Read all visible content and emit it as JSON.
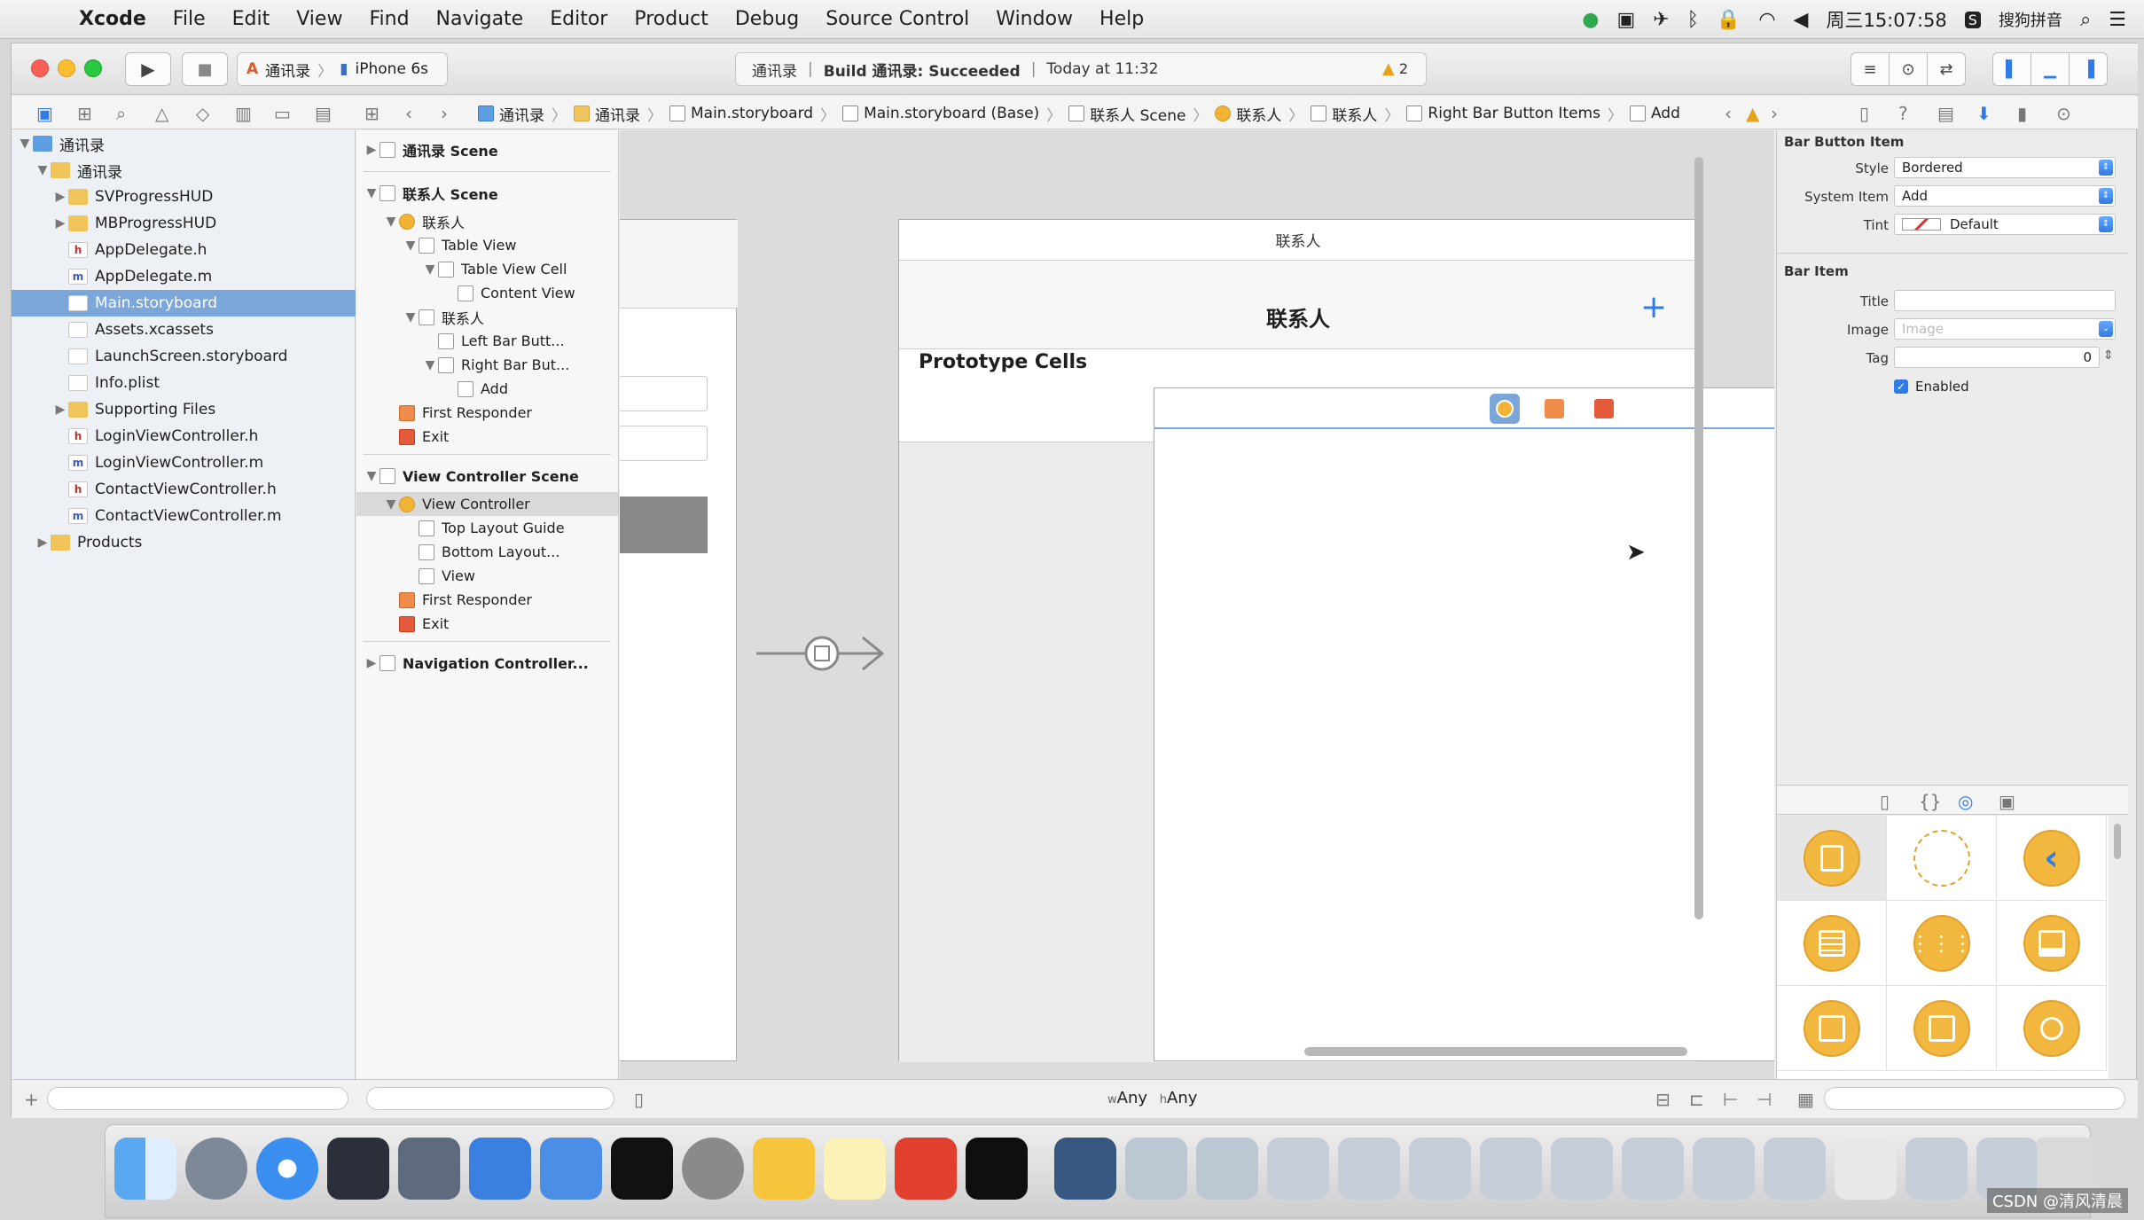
{
  "menubar": {
    "app": "Xcode",
    "items": [
      "File",
      "Edit",
      "View",
      "Find",
      "Navigate",
      "Editor",
      "Product",
      "Debug",
      "Source Control",
      "Window",
      "Help"
    ],
    "clock": "周三15:07:58",
    "input_method": "搜狗拼音"
  },
  "toolbar": {
    "scheme_target": "通讯录",
    "scheme_device": "iPhone 6s",
    "activity_target": "通讯录",
    "activity_build": "Build 通讯录: Succeeded",
    "activity_time": "Today at 11:32",
    "warning_count": "2"
  },
  "jumpbar": [
    "通讯录",
    "通讯录",
    "Main.storyboard",
    "Main.storyboard (Base)",
    "联系人 Scene",
    "联系人",
    "联系人",
    "Right Bar Button Items",
    "Add"
  ],
  "navigator": {
    "project": "通讯录",
    "items": [
      {
        "label": "通讯录",
        "type": "folder",
        "indent": 1,
        "disclosure": "▼"
      },
      {
        "label": "SVProgressHUD",
        "type": "folder",
        "indent": 2,
        "disclosure": "▶"
      },
      {
        "label": "MBProgressHUD",
        "type": "folder",
        "indent": 2,
        "disclosure": "▶"
      },
      {
        "label": "AppDelegate.h",
        "type": "h",
        "indent": 2,
        "disclosure": ""
      },
      {
        "label": "AppDelegate.m",
        "type": "m",
        "indent": 2,
        "disclosure": ""
      },
      {
        "label": "Main.storyboard",
        "type": "s",
        "indent": 2,
        "disclosure": "",
        "selected": true
      },
      {
        "label": "Assets.xcassets",
        "type": "s",
        "indent": 2,
        "disclosure": ""
      },
      {
        "label": "LaunchScreen.storyboard",
        "type": "s",
        "indent": 2,
        "disclosure": ""
      },
      {
        "label": "Info.plist",
        "type": "s",
        "indent": 2,
        "disclosure": ""
      },
      {
        "label": "Supporting Files",
        "type": "folder",
        "indent": 2,
        "disclosure": "▶"
      },
      {
        "label": "LoginViewController.h",
        "type": "h",
        "indent": 2,
        "disclosure": ""
      },
      {
        "label": "LoginViewController.m",
        "type": "m",
        "indent": 2,
        "disclosure": ""
      },
      {
        "label": "ContactViewController.h",
        "type": "h",
        "indent": 2,
        "disclosure": ""
      },
      {
        "label": "ContactViewController.m",
        "type": "m",
        "indent": 2,
        "disclosure": ""
      },
      {
        "label": "Products",
        "type": "folder",
        "indent": 1,
        "disclosure": "▶"
      }
    ]
  },
  "outline": {
    "rows": [
      {
        "label": "通讯录 Scene",
        "indent": 0,
        "disclosure": "▶",
        "section": true
      },
      {
        "label": "联系人 Scene",
        "indent": 0,
        "disclosure": "▼",
        "section": true
      },
      {
        "label": "联系人",
        "indent": 1,
        "disclosure": "▼",
        "icon": "vc"
      },
      {
        "label": "Table View",
        "indent": 2,
        "disclosure": "▼"
      },
      {
        "label": "Table View Cell",
        "indent": 3,
        "disclosure": "▼"
      },
      {
        "label": "Content View",
        "indent": 4,
        "disclosure": ""
      },
      {
        "label": "联系人",
        "indent": 2,
        "disclosure": "▼",
        "icon": "nav"
      },
      {
        "label": "Left Bar Butt...",
        "indent": 3,
        "disclosure": ""
      },
      {
        "label": "Right Bar But...",
        "indent": 3,
        "disclosure": "▼"
      },
      {
        "label": "Add",
        "indent": 4,
        "disclosure": ""
      },
      {
        "label": "First Responder",
        "indent": 1,
        "disclosure": "",
        "icon": "resp"
      },
      {
        "label": "Exit",
        "indent": 1,
        "disclosure": "",
        "icon": "exit"
      },
      {
        "label": "View Controller Scene",
        "indent": 0,
        "disclosure": "▼",
        "section": true
      },
      {
        "label": "View Controller",
        "indent": 1,
        "disclosure": "▼",
        "icon": "vc",
        "selected": true
      },
      {
        "label": "Top Layout Guide",
        "indent": 2,
        "disclosure": ""
      },
      {
        "label": "Bottom Layout...",
        "indent": 2,
        "disclosure": ""
      },
      {
        "label": "View",
        "indent": 2,
        "disclosure": ""
      },
      {
        "label": "First Responder",
        "indent": 1,
        "disclosure": "",
        "icon": "resp"
      },
      {
        "label": "Exit",
        "indent": 1,
        "disclosure": "",
        "icon": "exit"
      },
      {
        "label": "Navigation Controller...",
        "indent": 0,
        "disclosure": "▶",
        "section": true
      }
    ]
  },
  "canvas": {
    "scene_title": "联系人",
    "nav_title": "联系人",
    "add_symbol": "+",
    "prototype_label": "Prototype Cells",
    "size_class_w": "Any",
    "size_class_h": "Any"
  },
  "inspector": {
    "section1": "Bar Button Item",
    "style_label": "Style",
    "style_value": "Bordered",
    "system_item_label": "System Item",
    "system_item_value": "Add",
    "tint_label": "Tint",
    "tint_value": "Default",
    "section2": "Bar Item",
    "title_label": "Title",
    "title_value": "",
    "image_label": "Image",
    "image_placeholder": "Image",
    "tag_label": "Tag",
    "tag_value": "0",
    "enabled_label": "Enabled"
  },
  "watermark": "CSDN @清风清晨",
  "colors": {
    "selection": "#7aa6da",
    "accent": "#2f7be8",
    "warning": "#e5a21a",
    "vc_icon": "#f2b234"
  }
}
